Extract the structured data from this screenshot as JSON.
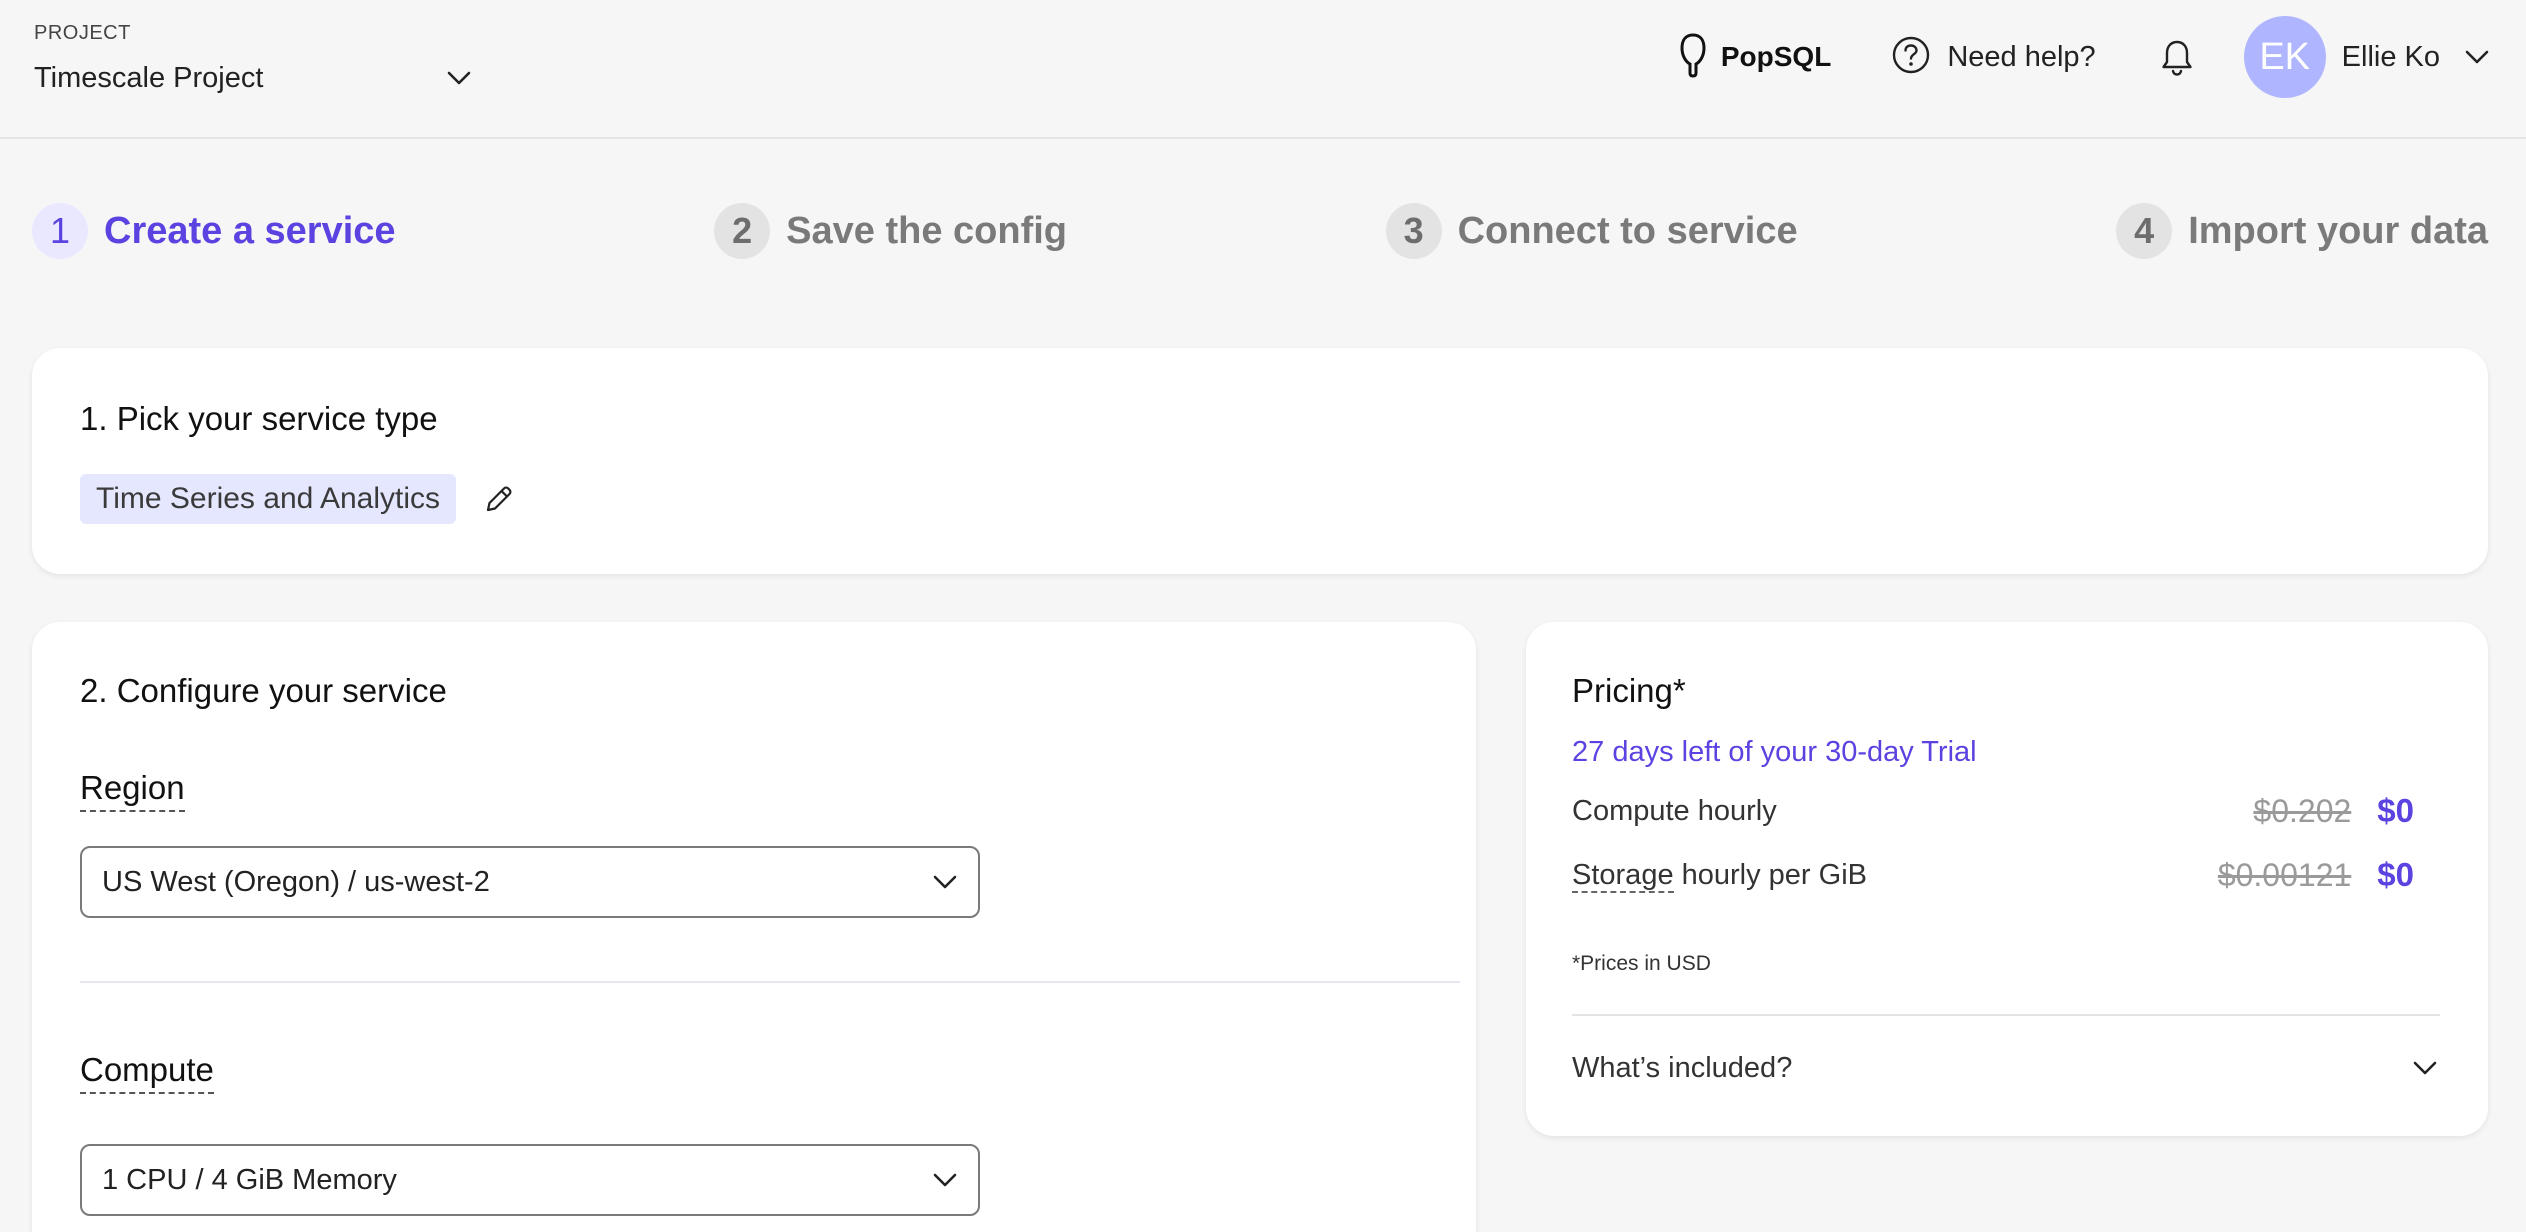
{
  "header": {
    "project_label": "PROJECT",
    "project_name": "Timescale Project",
    "popsql_label": "PopSQL",
    "help_label": "Need help?",
    "user_initials": "EK",
    "user_name": "Ellie Ko",
    "avatar_color": "#b0b5ff"
  },
  "stepper": {
    "steps": [
      {
        "num": "1",
        "label": "Create a service",
        "active": true
      },
      {
        "num": "2",
        "label": "Save the config",
        "active": false
      },
      {
        "num": "3",
        "label": "Connect to service",
        "active": false
      },
      {
        "num": "4",
        "label": "Import your data",
        "active": false
      }
    ],
    "accent_color": "#5a43e0"
  },
  "service_type": {
    "title": "1. Pick your service type",
    "selected": "Time Series and Analytics",
    "edit_icon": "pencil-icon"
  },
  "configure": {
    "title": "2. Configure your service",
    "region_label": "Region",
    "region_value": "US West (Oregon) / us-west-2",
    "compute_label": "Compute",
    "compute_value": "1 CPU / 4 GiB Memory"
  },
  "pricing": {
    "title": "Pricing*",
    "trial_text": "27 days left of your 30-day Trial",
    "compute_label": "Compute hourly",
    "compute_old": "$0.202",
    "compute_new": "$0",
    "storage_label_underlined": "Storage",
    "storage_label_rest": " hourly per GiB",
    "storage_old": "$0.00121",
    "storage_new": "$0",
    "note": "*Prices in USD",
    "included_label": "What’s included?"
  }
}
